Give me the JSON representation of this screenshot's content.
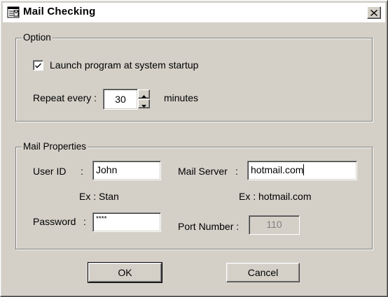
{
  "window": {
    "title": "Mail Checking",
    "close_glyph": "✕"
  },
  "option_group": {
    "label": "Option",
    "launch_checkbox": {
      "label": "Launch program at system startup",
      "checked": true
    },
    "repeat_label": "Repeat every :",
    "repeat_value": "30",
    "repeat_unit": "minutes"
  },
  "mail_group": {
    "label": "Mail Properties",
    "userid_label": "User ID",
    "userid_colon": ":",
    "userid_value": "John",
    "userid_example": "Ex : Stan",
    "server_label": "Mail Server",
    "server_colon": ":",
    "server_value": "hotmail.com",
    "server_example": "Ex : hotmail.com",
    "password_label": "Password",
    "password_colon": ":",
    "password_value": "****",
    "port_label": "Port Number :",
    "port_value": "110"
  },
  "buttons": {
    "ok_label": "OK",
    "cancel_label": "Cancel"
  },
  "icons": {
    "title": "mail-document-icon",
    "close": "close-icon",
    "check": "checkmark-icon",
    "spin_up": "spin-up-arrow-icon",
    "spin_down": "spin-down-arrow-icon"
  },
  "colors": {
    "face": "#d4d0c8",
    "shadow": "#808080",
    "highlight": "#ffffff",
    "dark": "#404040"
  }
}
